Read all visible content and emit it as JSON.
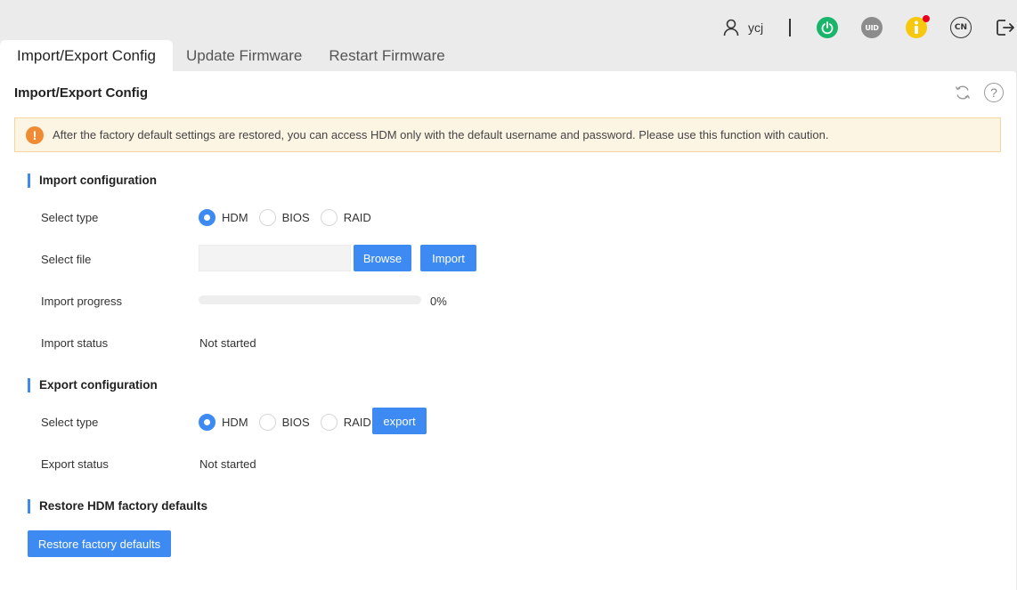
{
  "header": {
    "username": "ycj",
    "icons": {
      "user": "user-icon",
      "power": "power-icon",
      "uid": "UID",
      "info": "info-icon",
      "language": "CN",
      "logout": "logout-icon"
    },
    "colors": {
      "power": "#19b56b",
      "uid": "#8c8c8c",
      "info": "#f7c80e",
      "alert_dot": "#e8001e"
    }
  },
  "tabs": [
    {
      "label": "Import/Export Config",
      "active": true
    },
    {
      "label": "Update Firmware",
      "active": false
    },
    {
      "label": "Restart Firmware",
      "active": false
    }
  ],
  "panel": {
    "title": "Import/Export Config",
    "alert": "After the factory default settings are restored, you can access HDM only with the default username and password. Please use this function with caution."
  },
  "import": {
    "section_title": "Import configuration",
    "select_type_label": "Select type",
    "types": [
      "HDM",
      "BIOS",
      "RAID"
    ],
    "selected_type": "HDM",
    "select_file_label": "Select file",
    "file_value": "",
    "browse_label": "Browse",
    "import_label": "Import",
    "progress_label": "Import progress",
    "progress_percent": 0,
    "progress_text": "0%",
    "status_label": "Import status",
    "status_value": "Not started"
  },
  "export": {
    "section_title": "Export configuration",
    "select_type_label": "Select type",
    "types": [
      "HDM",
      "BIOS",
      "RAID"
    ],
    "selected_type": "HDM",
    "export_label": "export",
    "status_label": "Export status",
    "status_value": "Not started"
  },
  "restore": {
    "section_title": "Restore HDM factory defaults",
    "button_label": "Restore factory defaults"
  },
  "accent_color": "#3d8bf2"
}
